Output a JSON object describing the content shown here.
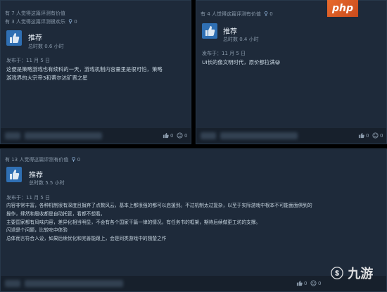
{
  "reviews": [
    {
      "helpful_text": "有 7 人觉得这篇评测有价值",
      "funny_text": "有 3 人觉得这篇评测很欢乐",
      "award_count": "0",
      "verdict": "推荐",
      "hours": "总时数 0.6 小时",
      "posted": "发布于：11 月 5 日",
      "lines": [
        "这便是策略游戏也有续科的一天，游戏机制内容量里是很可怕，策略",
        "游戏界的大宗帝3和蒂尔达矿晋之星"
      ],
      "votes_up": "0",
      "votes_funny": "0"
    },
    {
      "helpful_text": "有 4 人觉得这篇评测有价值",
      "award_count": "0",
      "verdict": "推荐",
      "hours": "总时数 0.4 小时",
      "posted": "发布于：11 月 5 日",
      "lines": [
        "UI长的像文明时代，原价都拉满😀"
      ],
      "votes_up": "0",
      "votes_funny": "0"
    },
    {
      "helpful_text": "有 13 人觉得这篇评测有价值",
      "award_count": "0",
      "verdict": "推荐",
      "hours": "总时数 5.5 小时",
      "posted": "发布于：11 月 5 日",
      "lines": [
        "内容非常丰富，各种机制很有深度且摒弃了点数风云，基本上都很强的都可以启援到。不过机制太过复杂，以至于实际游戏中根本不可能面面俱到的",
        "操作，肆然和殷收都是自动托管，看都不想看。",
        "主要国家都有风味内容，差异化相当明显，不会有各个国家干篇一律的情况，有任务书的框架，期待后续做更工坊的支撑。",
        "闪退是个问题，比较吃中体验",
        "总体而言符合入设，如果后续优化和完善能跟上，会是同类游戏中的翘楚之作"
      ],
      "votes_up": "0",
      "votes_funny": "0"
    }
  ],
  "watermark_php": "php",
  "watermark_site": "九游"
}
